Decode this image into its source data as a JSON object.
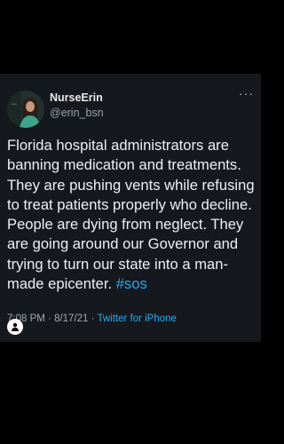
{
  "tweet": {
    "display_name": "NurseErin",
    "handle": "@erin_bsn",
    "more_icon": "more-icon",
    "text": "Florida hospital administrators are banning medication and treatments. They are pushing vents while refusing to treat patients properly who decline. People are dying from neglect. They are going around our Governor and trying to turn our state into a man-made epicenter. ",
    "hashtag": "#sos",
    "time": "7:08 PM",
    "separator": " · ",
    "date": "8/17/21",
    "source": "Twitter for iPhone"
  },
  "icons": {
    "avatar": "profile-photo",
    "overlay": "person-icon"
  }
}
